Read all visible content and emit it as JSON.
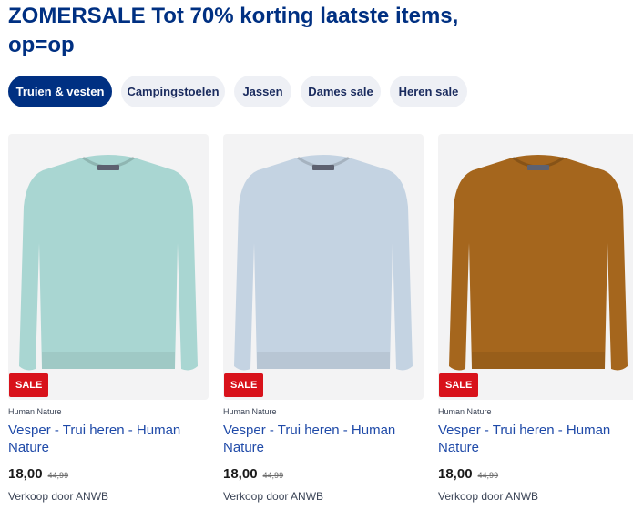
{
  "header": {
    "title": "ZOMERSALE Tot 70% korting laatste items, op=op"
  },
  "filters": [
    {
      "label": "Truien & vesten",
      "active": true
    },
    {
      "label": "Campingstoelen",
      "active": false
    },
    {
      "label": "Jassen",
      "active": false
    },
    {
      "label": "Dames sale",
      "active": false
    },
    {
      "label": "Heren sale",
      "active": false
    }
  ],
  "products": [
    {
      "badge": "SALE",
      "brand": "Human Nature",
      "name": "Vesper - Trui heren - Human Nature",
      "price": "18,00",
      "old_price": "44,99",
      "seller": "Verkoop door ANWB",
      "color": "#a9d6d2",
      "icon": "sweater-icon"
    },
    {
      "badge": "SALE",
      "brand": "Human Nature",
      "name": "Vesper - Trui heren - Human Nature",
      "price": "18,00",
      "old_price": "44,99",
      "seller": "Verkoop door ANWB",
      "color": "#c4d3e2",
      "icon": "sweater-icon"
    },
    {
      "badge": "SALE",
      "brand": "Human Nature",
      "name": "Vesper - Trui heren - Human Nature",
      "price": "18,00",
      "old_price": "44,99",
      "seller": "Verkoop door ANWB",
      "color": "#a5661d",
      "icon": "sweater-icon"
    }
  ],
  "colors": {
    "brand_blue": "#003082",
    "link_blue": "#1f4aa8",
    "sale_red": "#d8121b"
  }
}
